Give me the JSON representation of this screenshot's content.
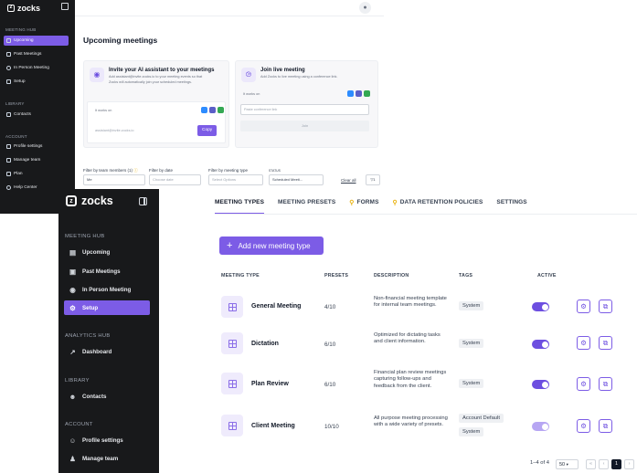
{
  "back": {
    "brand": "zocks",
    "nav": {
      "meeting_hub_title": "MEETING HUB",
      "upcoming": "Upcoming",
      "past_meetings": "Past Meetings",
      "in_person": "In Person Meeting",
      "setup": "Setup",
      "library_title": "LIBRARY",
      "contacts": "Contacts",
      "account_title": "ACCOUNT",
      "profile": "Profile settings",
      "manage_team": "Manage team",
      "plan": "Plan",
      "help": "Help Center"
    },
    "page_title": "Upcoming meetings",
    "invite_card": {
      "title": "Invite your AI assistant to your meetings",
      "desc": "Add assistant@invite.zocks.io to your meeting events so that Zocks will automatically join your scheduled meetings.",
      "works_on": "It works on",
      "email": "assistant@invite.zocks.io",
      "copy_label": "Copy"
    },
    "join_card": {
      "title": "Join live meeting",
      "desc": "Add Zocks to live meeting using a conference link.",
      "works_on": "It works on",
      "placeholder": "Paste conference link",
      "join_label": "Join"
    },
    "filters": {
      "team_label": "Filter by team members (1)",
      "team_value": "Me",
      "date_label": "Filter by date",
      "date_value": "Choose date",
      "type_label": "Filter by meeting type",
      "type_value": "Select Options",
      "status_label": "STATUS",
      "status_value": "Scheduled Meeti...",
      "clear_all": "Clear all",
      "filter_count": "1"
    }
  },
  "front": {
    "brand": "zocks",
    "nav": {
      "meeting_hub_title": "MEETING HUB",
      "upcoming": "Upcoming",
      "past_meetings": "Past Meetings",
      "in_person": "In Person Meeting",
      "setup": "Setup",
      "analytics_title": "ANALYTICS HUB",
      "dashboard": "Dashboard",
      "library_title": "LIBRARY",
      "contacts": "Contacts",
      "account_title": "ACCOUNT",
      "profile": "Profile settings",
      "manage_team": "Manage team"
    },
    "tabs": {
      "meeting_types": "MEETING TYPES",
      "meeting_presets": "MEETING PRESETS",
      "forms": "FORMS",
      "data_retention": "DATA RETENTION POLICIES",
      "settings": "SETTINGS"
    },
    "add_button": "Add new meeting type",
    "columns": {
      "type": "MEETING TYPE",
      "presets": "PRESETS",
      "description": "DESCRIPTION",
      "tags": "TAGS",
      "active": "ACTIVE"
    },
    "rows": [
      {
        "name": "General Meeting",
        "presets": "4/10",
        "description": "Non-financial meeting template for internal team meetings.",
        "tag1": "System",
        "tag2": ""
      },
      {
        "name": "Dictation",
        "presets": "6/10",
        "description": "Optimized for dictating tasks and client information.",
        "tag1": "System",
        "tag2": ""
      },
      {
        "name": "Plan Review",
        "presets": "6/10",
        "description": "Financial plan review meetings capturing follow-ups and feedback from the client.",
        "tag1": "System",
        "tag2": ""
      },
      {
        "name": "Client Meeting",
        "presets": "10/10",
        "description": "All purpose meeting processing with a wide variety of presets.",
        "tag1": "Account Default",
        "tag2": "System"
      }
    ],
    "pagination": {
      "range": "1–4 of 4",
      "page_size": "50",
      "current_page": "1"
    }
  }
}
